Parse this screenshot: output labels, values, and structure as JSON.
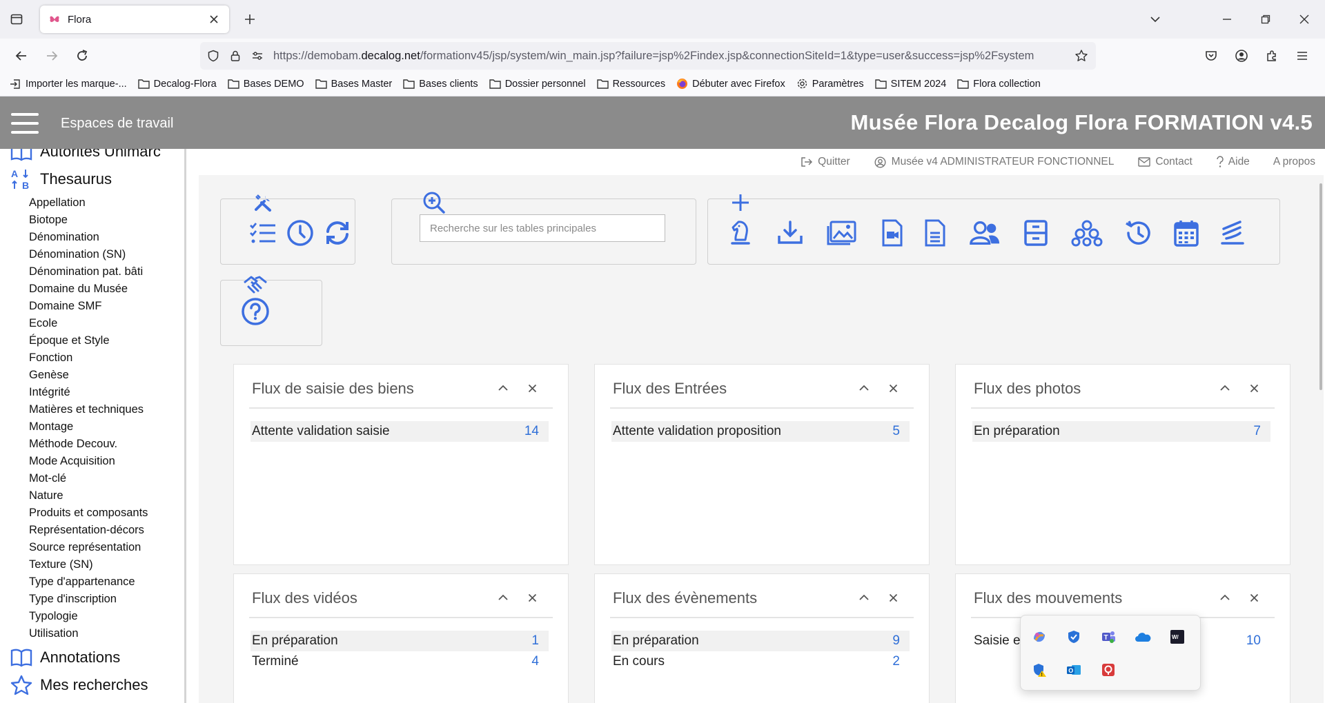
{
  "browser": {
    "tab_title": "Flora",
    "url_prefix": "https://demobam.",
    "url_domain": "decalog.net",
    "url_rest": "/formationv45/jsp/system/win_main.jsp?failure=jsp%2Findex.jsp&connectionSiteId=1&type=user&success=jsp%2Fsystem",
    "bookmarks": [
      {
        "label": "Importer les marque-...",
        "icon": "import-icon"
      },
      {
        "label": "Decalog-Flora",
        "icon": "folder-icon"
      },
      {
        "label": "Bases DEMO",
        "icon": "folder-icon"
      },
      {
        "label": "Bases Master",
        "icon": "folder-icon"
      },
      {
        "label": "Bases clients",
        "icon": "folder-icon"
      },
      {
        "label": "Dossier personnel",
        "icon": "folder-icon"
      },
      {
        "label": "Ressources",
        "icon": "folder-icon"
      },
      {
        "label": "Débuter avec Firefox",
        "icon": "firefox-icon"
      },
      {
        "label": "Paramètres",
        "icon": "gear-icon"
      },
      {
        "label": "SITEM 2024",
        "icon": "folder-icon"
      },
      {
        "label": "Flora collection",
        "icon": "folder-icon"
      }
    ]
  },
  "header": {
    "workspaces_label": "Espaces de travail",
    "title": "Musée Flora Decalog Flora FORMATION v4.5"
  },
  "sidebar": {
    "partial_section": "Autorités Unimarc",
    "thesaurus_label": "Thesaurus",
    "items": [
      "Appellation",
      "Biotope",
      "Dénomination",
      "Dénomination (SN)",
      "Dénomination pat. bâti",
      "Domaine du Musée",
      "Domaine SMF",
      "Ecole",
      "Époque et Style",
      "Fonction",
      "Genèse",
      "Intégrité",
      "Matières et techniques",
      "Montage",
      "Méthode Decouv.",
      "Mode Acquisition",
      "Mot-clé",
      "Nature",
      "Produits et composants",
      "Représentation-décors",
      "Source représentation",
      "Texture (SN)",
      "Type d'appartenance",
      "Type d'inscription",
      "Typologie",
      "Utilisation"
    ],
    "annotations_label": "Annotations",
    "searches_label": "Mes recherches"
  },
  "topmenu": {
    "quit": "Quitter",
    "user": "Musée v4 ADMINISTRATEUR FONCTIONNEL",
    "contact": "Contact",
    "help": "Aide",
    "about": "A propos"
  },
  "search": {
    "placeholder": "Recherche sur les tables principales"
  },
  "panels": [
    {
      "title": "Flux de saisie des biens",
      "rows": [
        {
          "label": "Attente validation saisie",
          "count": "14"
        }
      ]
    },
    {
      "title": "Flux des Entrées",
      "rows": [
        {
          "label": "Attente validation proposition",
          "count": "5"
        }
      ]
    },
    {
      "title": "Flux des photos",
      "rows": [
        {
          "label": "En préparation",
          "count": "7"
        }
      ]
    },
    {
      "title": "Flux des vidéos",
      "rows": [
        {
          "label": "En préparation",
          "count": "1"
        },
        {
          "label": "Terminé",
          "count": "4"
        }
      ]
    },
    {
      "title": "Flux des évènements",
      "rows": [
        {
          "label": "En préparation",
          "count": "9"
        },
        {
          "label": "En cours",
          "count": "2"
        }
      ]
    },
    {
      "title": "Flux des mouvements",
      "rows": [
        {
          "label": "Saisie e",
          "count": "10"
        }
      ]
    }
  ],
  "colors": {
    "accent": "#3d6fe0",
    "header_bg": "#8b8b8b",
    "count_link": "#2f6fd8"
  }
}
